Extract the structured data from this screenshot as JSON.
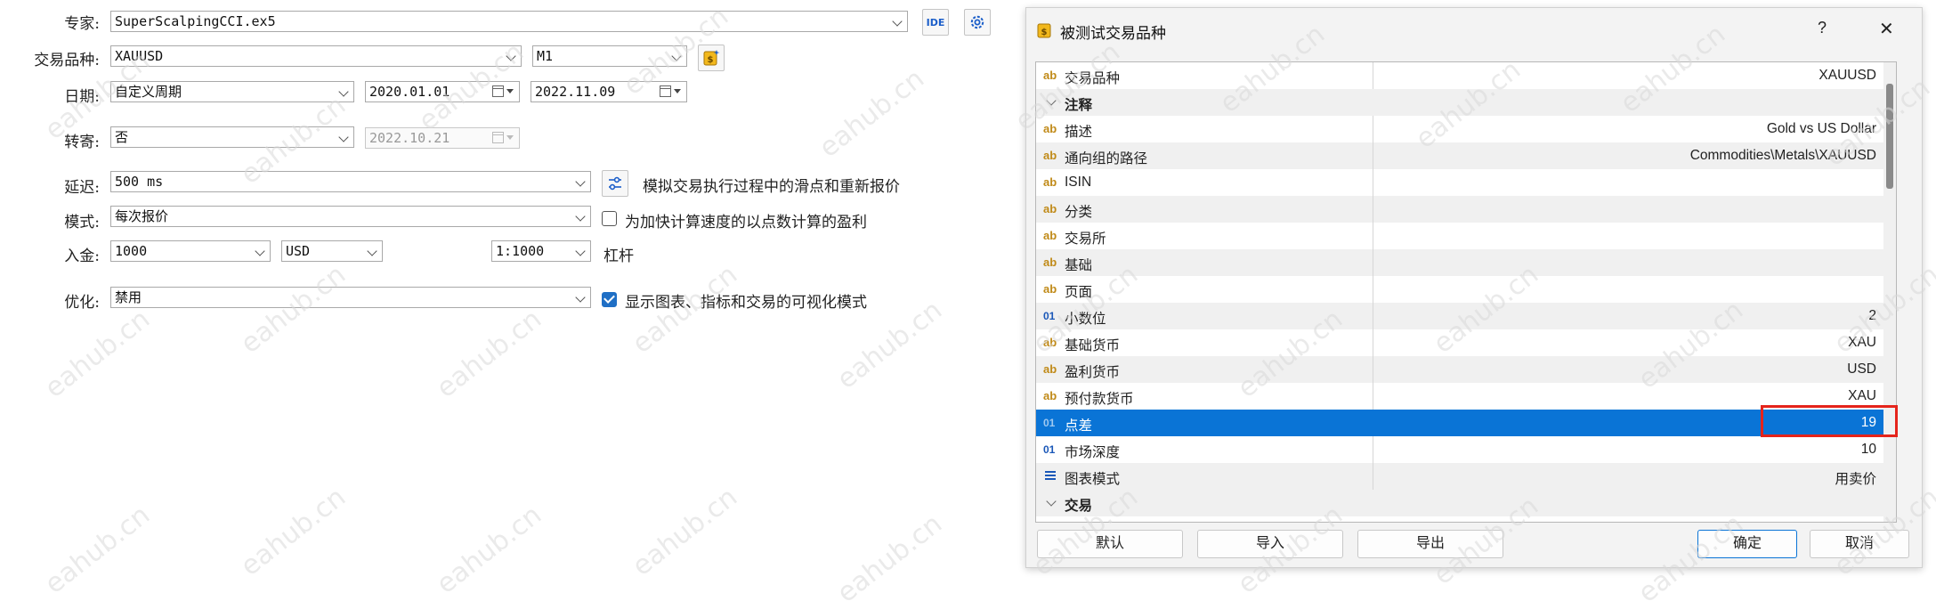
{
  "form": {
    "expert_label": "专家:",
    "expert_value": "SuperScalpingCCI.ex5",
    "ide_label": "IDE",
    "symbol_label": "交易品种:",
    "symbol_value": "XAUUSD",
    "timeframe_value": "M1",
    "date_label": "日期:",
    "date_mode_value": "自定义周期",
    "date_from": "2020.01.01",
    "date_to": "2022.11.09",
    "forward_label": "转寄:",
    "forward_value": "否",
    "forward_date": "2022.10.21",
    "delay_label": "延迟:",
    "delay_value": "500 ms",
    "delay_note": "模拟交易执行过程中的滑点和重新报价",
    "model_label": "模式:",
    "model_value": "每次报价",
    "model_check_label": "为加快计算速度的以点数计算的盈利",
    "model_check_checked": false,
    "deposit_label": "入金:",
    "deposit_value": "1000",
    "currency_value": "USD",
    "leverage_value": "1:1000",
    "leverage_label": "杠杆",
    "optimization_label": "优化:",
    "optimization_value": "禁用",
    "visual_check_label": "显示图表、指标和交易的可视化模式",
    "visual_check_checked": true
  },
  "dialog": {
    "title": "被测试交易品种",
    "help_glyph": "?",
    "close_glyph": "✕",
    "rows": [
      {
        "type": "prop",
        "icon": "ab",
        "name": "交易品种",
        "value": "XAUUSD"
      },
      {
        "type": "group",
        "name": "注释"
      },
      {
        "type": "prop",
        "icon": "ab",
        "name": "描述",
        "value": "Gold vs US Dollar"
      },
      {
        "type": "prop",
        "icon": "ab",
        "name": "通向组的路径",
        "value": "Commodities\\Metals\\XAUUSD"
      },
      {
        "type": "prop",
        "icon": "ab",
        "name": "ISIN",
        "value": ""
      },
      {
        "type": "prop",
        "icon": "ab",
        "name": "分类",
        "value": ""
      },
      {
        "type": "prop",
        "icon": "ab",
        "name": "交易所",
        "value": ""
      },
      {
        "type": "prop",
        "icon": "ab",
        "name": "基础",
        "value": ""
      },
      {
        "type": "prop",
        "icon": "ab",
        "name": "页面",
        "value": ""
      },
      {
        "type": "prop",
        "icon": "01",
        "name": "小数位",
        "value": "2"
      },
      {
        "type": "prop",
        "icon": "ab",
        "name": "基础货币",
        "value": "XAU"
      },
      {
        "type": "prop",
        "icon": "ab",
        "name": "盈利货币",
        "value": "USD"
      },
      {
        "type": "prop",
        "icon": "ab",
        "name": "预付款货币",
        "value": "XAU"
      },
      {
        "type": "prop",
        "icon": "01",
        "name": "点差",
        "value": "19",
        "selected": true,
        "highlighted": true
      },
      {
        "type": "prop",
        "icon": "01",
        "name": "市场深度",
        "value": "10"
      },
      {
        "type": "prop",
        "icon": "list",
        "name": "图表模式",
        "value": "用卖价"
      },
      {
        "type": "group",
        "name": "交易"
      }
    ],
    "buttons": {
      "default": "默认",
      "import": "导入",
      "export": "导出",
      "ok": "确定",
      "cancel": "取消"
    }
  },
  "watermark": "eahub.cn",
  "colors": {
    "selection": "#0a74d6",
    "highlight_box": "#e5241b",
    "checkbox_on": "#1f6fc5"
  }
}
